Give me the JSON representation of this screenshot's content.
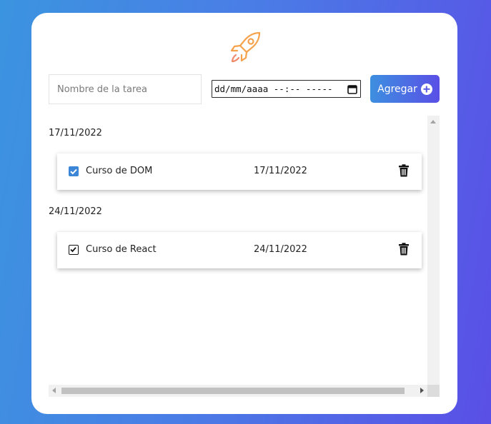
{
  "logo": {
    "icon": "rocket-icon",
    "color": "#f5a24b"
  },
  "form": {
    "task_placeholder": "Nombre de la tarea",
    "date_value": "dd/mm/aaaa --:-- -----",
    "add_label": "Agregar",
    "add_icon": "plus-circle-icon"
  },
  "groups": [
    {
      "heading": "17/11/2022",
      "tasks": [
        {
          "name": "Curso de DOM",
          "date": "17/11/2022",
          "completed": true,
          "check_style": "filled"
        }
      ]
    },
    {
      "heading": "24/11/2022",
      "tasks": [
        {
          "name": "Curso de React",
          "date": "24/11/2022",
          "completed": true,
          "check_style": "outline"
        }
      ]
    }
  ],
  "colors": {
    "accent_start": "#3d8fe0",
    "accent_end": "#5a4fe6",
    "checkbox_blue": "#3b86d6"
  }
}
